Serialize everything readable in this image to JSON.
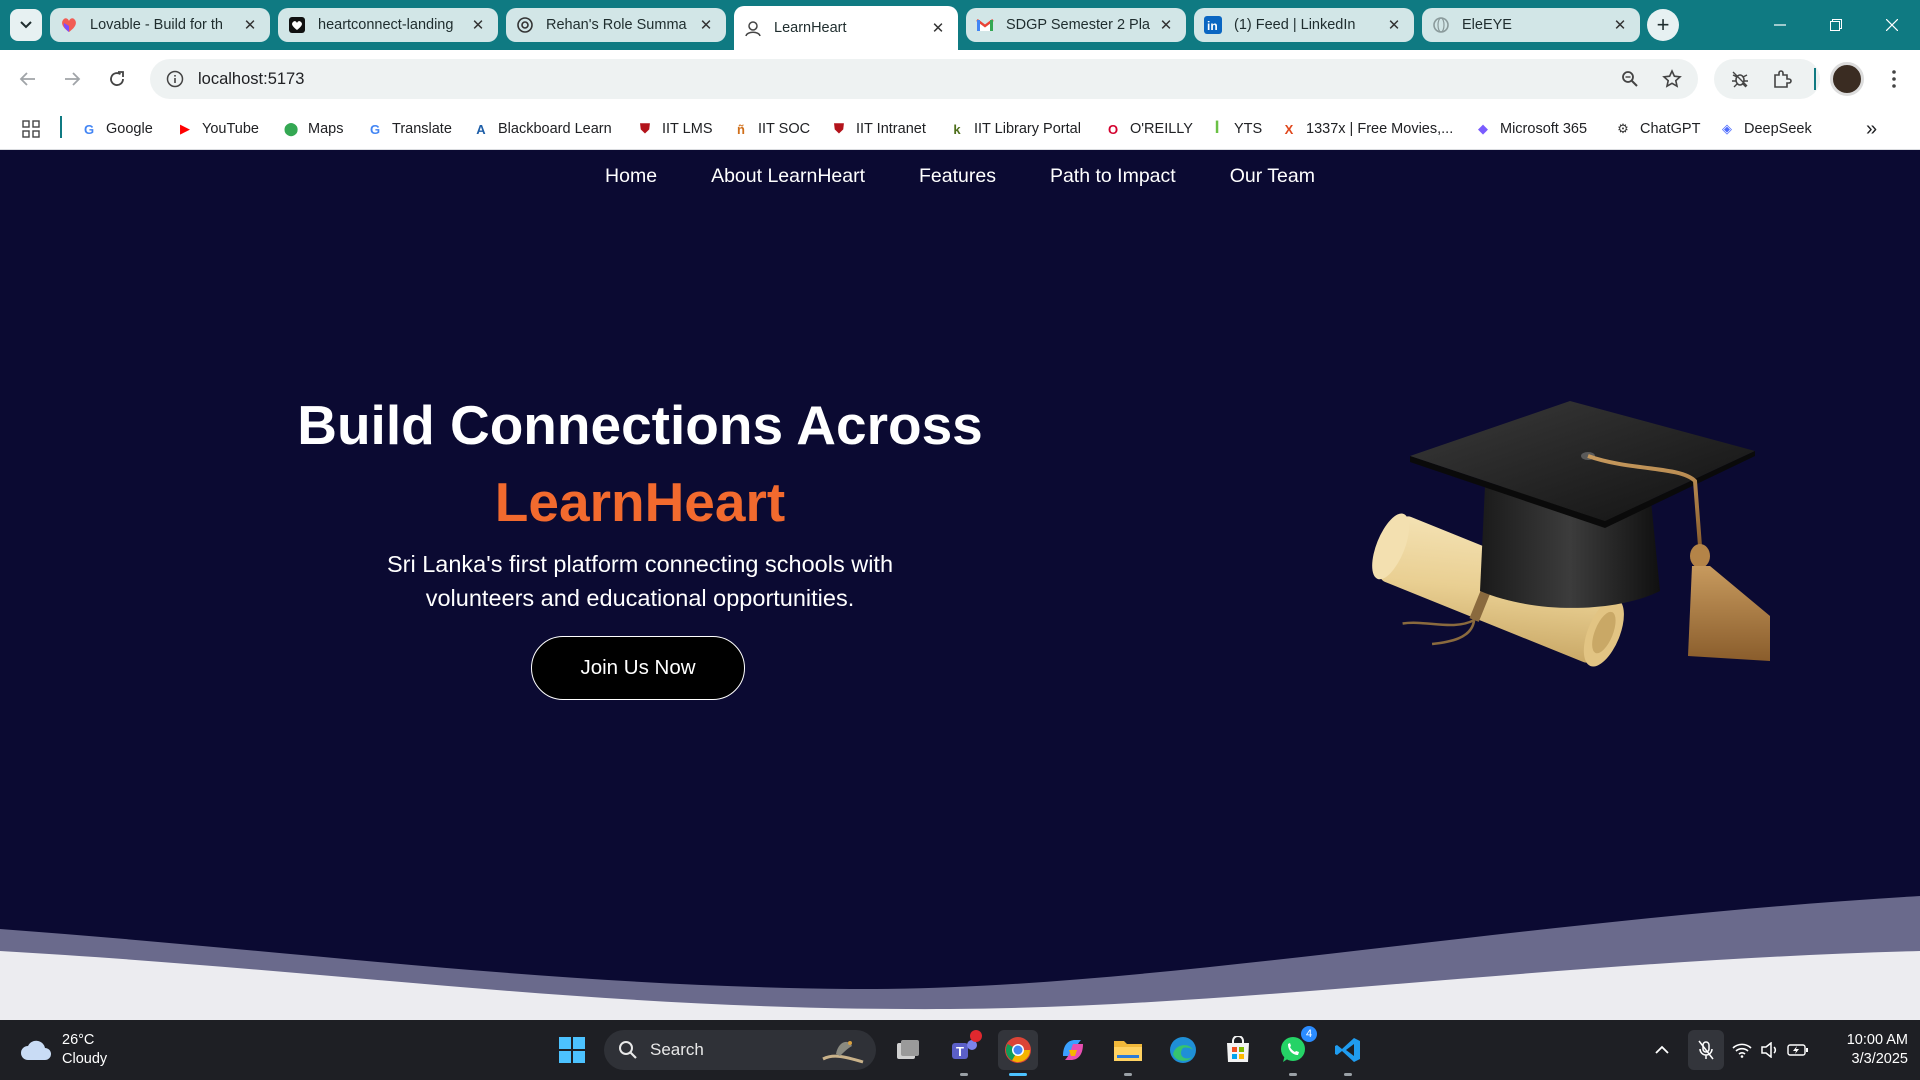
{
  "browser": {
    "tabs": [
      {
        "label": "Lovable - Build for th",
        "icon": "lovable-heart-icon"
      },
      {
        "label": "heartconnect-landing",
        "icon": "heart-card-icon"
      },
      {
        "label": "Rehan's Role Summa",
        "icon": "openai-icon"
      },
      {
        "label": "LearnHeart",
        "icon": "page-icon",
        "active": true
      },
      {
        "label": "SDGP Semester 2 Pla",
        "icon": "gmail-icon"
      },
      {
        "label": "(1) Feed | LinkedIn",
        "icon": "linkedin-icon"
      },
      {
        "label": "EleEYE",
        "icon": "globe-icon"
      }
    ],
    "url": "localhost:5173",
    "bookmarks": [
      {
        "label": "Google",
        "icon": "google-icon",
        "color": "#4285f4"
      },
      {
        "label": "YouTube",
        "icon": "youtube-icon",
        "color": "#ff0000"
      },
      {
        "label": "Maps",
        "icon": "maps-pin-icon",
        "color": "#34a853"
      },
      {
        "label": "Translate",
        "icon": "translate-icon",
        "color": "#4285f4"
      },
      {
        "label": "Blackboard Learn",
        "icon": "blackboard-icon",
        "color": "#1d5ea8"
      },
      {
        "label": "IIT LMS",
        "icon": "shield-icon",
        "color": "#b3131b"
      },
      {
        "label": "IIT SOC",
        "icon": "soc-icon",
        "color": "#d06f1a"
      },
      {
        "label": "IIT Intranet",
        "icon": "shield-icon",
        "color": "#b3131b"
      },
      {
        "label": "IIT Library Portal",
        "icon": "library-k-icon",
        "color": "#4d6e1a"
      },
      {
        "label": "O'REILLY",
        "icon": "oreilly-icon",
        "color": "#d3002d"
      },
      {
        "label": "YTS",
        "icon": "yts-icon",
        "color": "#6ac045"
      },
      {
        "label": "1337x | Free Movies,...",
        "icon": "x-icon",
        "color": "#e0471c"
      },
      {
        "label": "Microsoft 365",
        "icon": "m365-icon",
        "color": "#7a5cff"
      },
      {
        "label": "ChatGPT",
        "icon": "openai-icon",
        "color": "#333333"
      },
      {
        "label": "DeepSeek",
        "icon": "deepseek-whale-icon",
        "color": "#4d6bfe"
      }
    ]
  },
  "site": {
    "nav": [
      "Home",
      "About LearnHeart",
      "Features",
      "Path to Impact",
      "Our Team"
    ],
    "hero": {
      "title": "Build Connections Across",
      "brand": "LearnHeart",
      "subtitle": "Sri Lanka's first platform connecting schools with volunteers and educational opportunities.",
      "cta": "Join Us Now"
    },
    "colors": {
      "background": "#0b0a32",
      "accent": "#f26a2e",
      "wave": "#6a6a8c"
    },
    "image": "graduation-cap-and-diploma-illustration"
  },
  "taskbar": {
    "weather": {
      "temp": "26°C",
      "condition": "Cloudy"
    },
    "search_label": "Search",
    "time": "10:00 AM",
    "date": "3/3/2025",
    "whatsapp_badge": "4"
  }
}
